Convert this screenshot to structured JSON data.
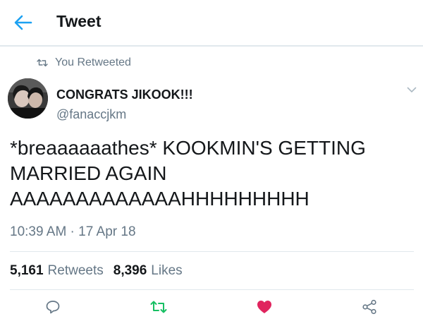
{
  "header": {
    "back_icon": "arrow-left-icon",
    "title": "Tweet"
  },
  "retweet_context": {
    "icon": "retweet-icon",
    "text": "You Retweeted"
  },
  "tweet": {
    "display_name": "CONGRATS JIKOOK!!!",
    "handle": "@fanaccjkm",
    "text_lines": [
      "*breaaaaaathes* KOOKMIN'S GETTING",
      "MARRIED AGAIN",
      "AAAAAAAAAAAAAHHHHHHHHH"
    ],
    "timestamp": "10:39 AM · 17 Apr 18",
    "retweets_count": "5,161",
    "retweets_label": "Retweets",
    "likes_count": "8,396",
    "likes_label": "Likes",
    "liked": true,
    "retweeted": true
  },
  "colors": {
    "accent_blue": "#1da1f2",
    "retweet_green": "#17bf63",
    "like_red": "#e0245e",
    "muted_gray": "#657786",
    "text_dark": "#14171a",
    "divider": "#e1e8ed"
  },
  "actions": [
    {
      "name": "reply",
      "icon": "reply-icon"
    },
    {
      "name": "retweet",
      "icon": "retweet-icon"
    },
    {
      "name": "like",
      "icon": "heart-icon"
    },
    {
      "name": "share",
      "icon": "share-icon"
    }
  ]
}
